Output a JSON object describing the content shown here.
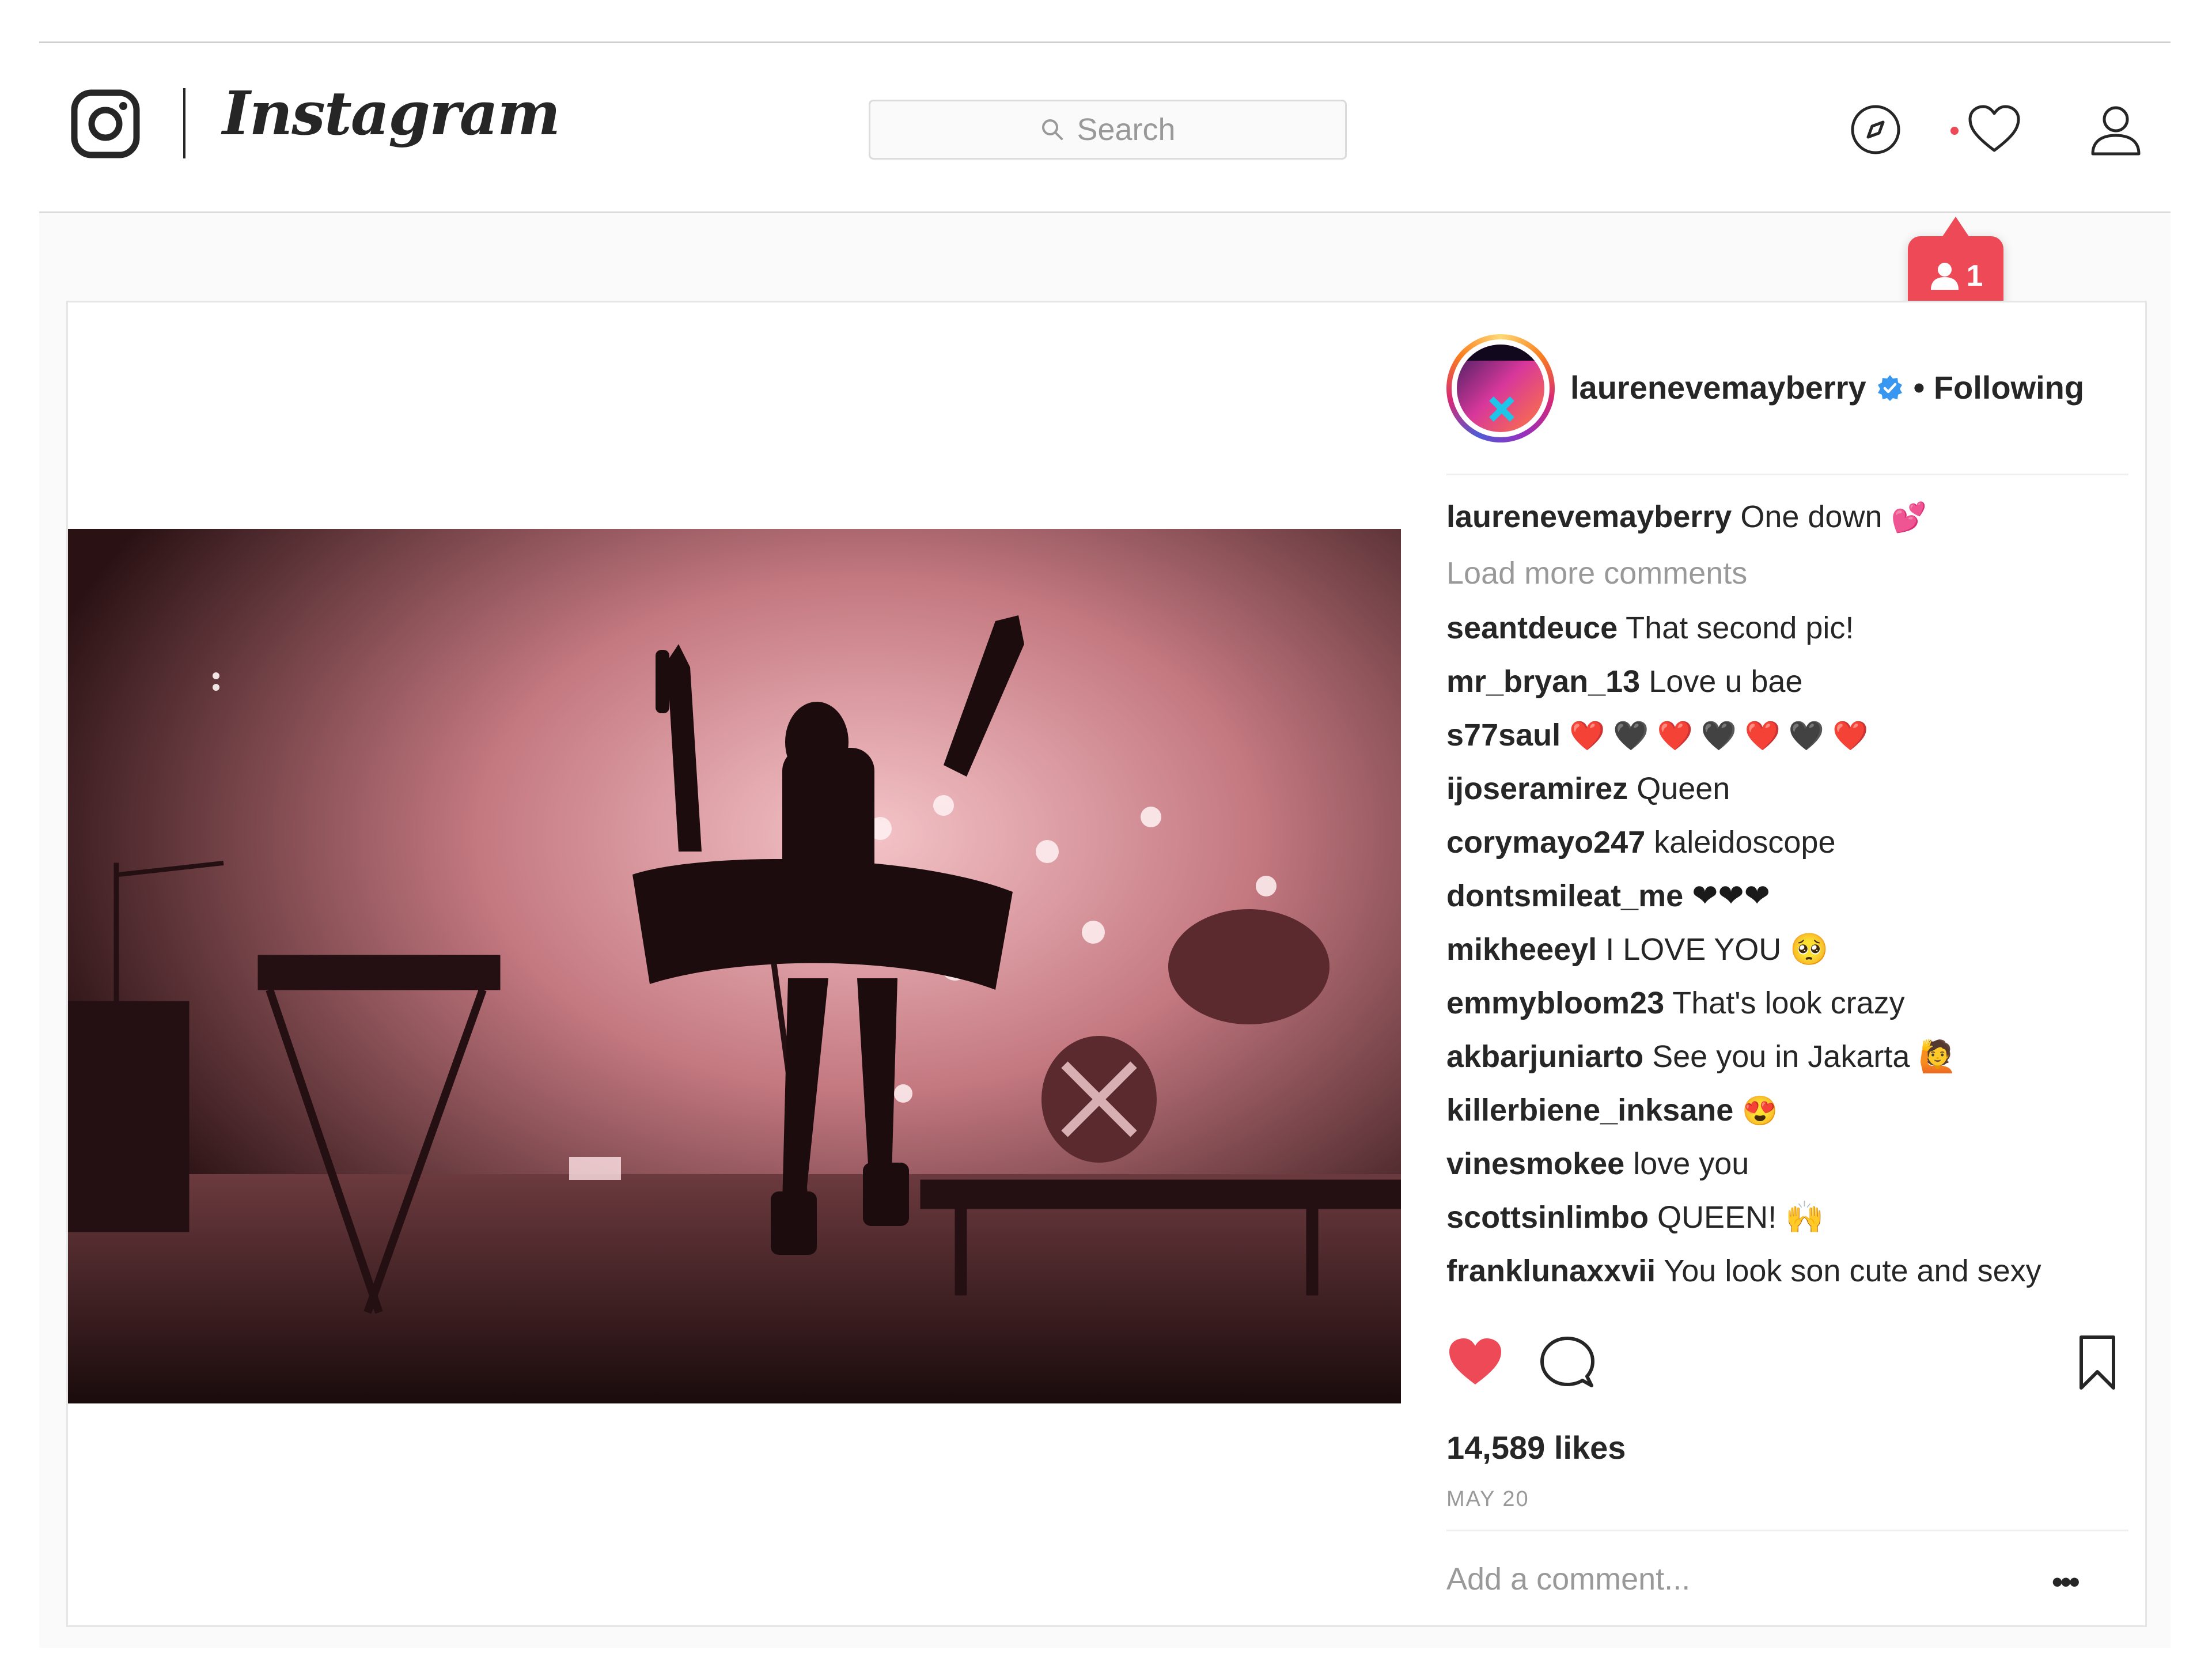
{
  "header": {
    "brand": "Instagram",
    "search_placeholder": "Search",
    "notification_count": "1"
  },
  "post": {
    "author": "laurenevemayberry",
    "follow_status": "• Following",
    "caption_text": "One down",
    "caption_emoji": "💕",
    "load_more_label": "Load more comments",
    "comments": [
      {
        "user": "seantdeuce",
        "text": "That second pic!"
      },
      {
        "user": "mr_bryan_13",
        "text": "Love u bae"
      },
      {
        "user": "s77saul",
        "text": "❤️ 🖤 ❤️ 🖤 ❤️ 🖤 ❤️"
      },
      {
        "user": "ijoseramirez",
        "text": "Queen"
      },
      {
        "user": "corymayo247",
        "text": "kaleidoscope"
      },
      {
        "user": "dontsmileat_me",
        "text": "❤❤❤"
      },
      {
        "user": "mikheeeyl",
        "text": "I LOVE YOU 🥺"
      },
      {
        "user": "emmybloom23",
        "text": "That's look crazy"
      },
      {
        "user": "akbarjuniarto",
        "text": "See you in Jakarta 🙋"
      },
      {
        "user": "killerbiene_inksane",
        "text": "😍"
      },
      {
        "user": "vinesmokee",
        "text": "love you"
      },
      {
        "user": "scottsinlimbo",
        "text": "QUEEN! 🙌"
      },
      {
        "user": "franklunaxxvii",
        "text": "You look son cute and sexy"
      }
    ],
    "likes": "14,589 likes",
    "date": "MAY 20",
    "add_comment_placeholder": "Add a comment...",
    "more_label": "•••"
  },
  "colors": {
    "accent_red": "#ed4956",
    "verified_blue": "#3897f0",
    "photo_tint": "#e8a0a8"
  },
  "icons": [
    "instagram-glyph-icon",
    "search-icon",
    "compass-icon",
    "heart-icon",
    "person-icon",
    "follower-icon",
    "verified-badge-icon",
    "like-heart-icon",
    "comment-icon",
    "bookmark-icon"
  ]
}
